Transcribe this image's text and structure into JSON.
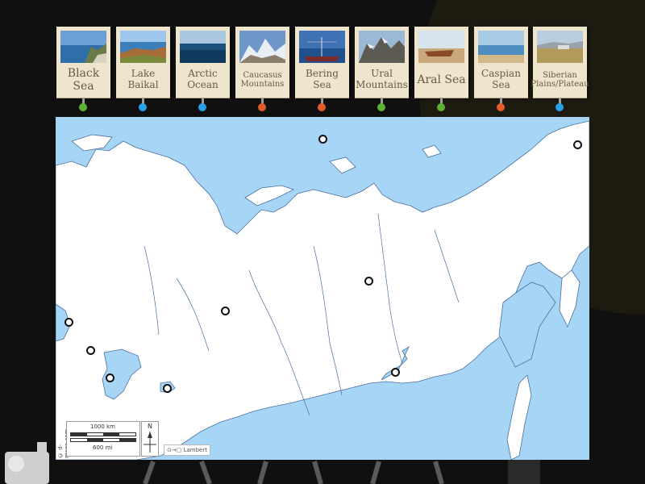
{
  "cards": [
    {
      "label": "Black Sea",
      "dot_color": "#5db234",
      "photo": "coast"
    },
    {
      "label": "Lake Baikal",
      "dot_color": "#2aa0e6",
      "photo": "lake"
    },
    {
      "label": "Arctic Ocean",
      "dot_color": "#2aa0e6",
      "photo": "ocean"
    },
    {
      "label": "Caucasus Mountains",
      "dot_color": "#e25c2b",
      "photo": "snow-mountains"
    },
    {
      "label": "Bering Sea",
      "dot_color": "#e25c2b",
      "photo": "ship-sea"
    },
    {
      "label": "Ural Mountains",
      "dot_color": "#5db234",
      "photo": "rocky-mountains"
    },
    {
      "label": "Aral Sea",
      "dot_color": "#5db234",
      "photo": "shipwreck"
    },
    {
      "label": "Caspian Sea",
      "dot_color": "#e25c2b",
      "photo": "shore"
    },
    {
      "label": "Siberian Plains/Plateau",
      "dot_color": "#2aa0e6",
      "photo": "plain"
    }
  ],
  "map": {
    "water_color": "#a6d5f5",
    "land_color": "#ffffff",
    "credit": "© d-maps.com",
    "scale_km": "1000 km",
    "scale_mi": "600 mi",
    "north": "N",
    "projection": "Lambert"
  }
}
